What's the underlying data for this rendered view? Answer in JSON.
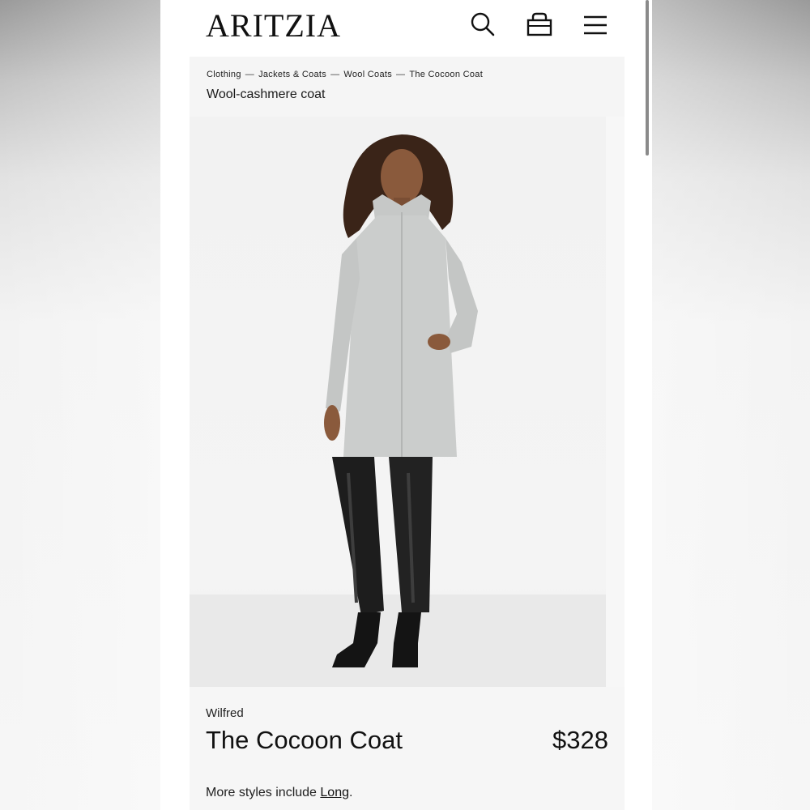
{
  "header": {
    "logo": "ARITZIA",
    "icons": [
      "search-icon",
      "bag-icon",
      "menu-icon"
    ]
  },
  "breadcrumb": {
    "items": [
      "Clothing",
      "Jackets & Coats",
      "Wool Coats",
      "The Cocoon Coat"
    ],
    "separator": "—"
  },
  "subtitle": "Wool-cashmere coat",
  "product": {
    "brand": "Wilfred",
    "name": "The Cocoon Coat",
    "price": "$328",
    "more_prefix": "More styles include ",
    "more_link": "Long",
    "more_suffix": "."
  },
  "colors": {
    "text": "#111111",
    "coat": "#c9cbca",
    "pants": "#1c1c1c",
    "panel": "#f5f5f5"
  }
}
